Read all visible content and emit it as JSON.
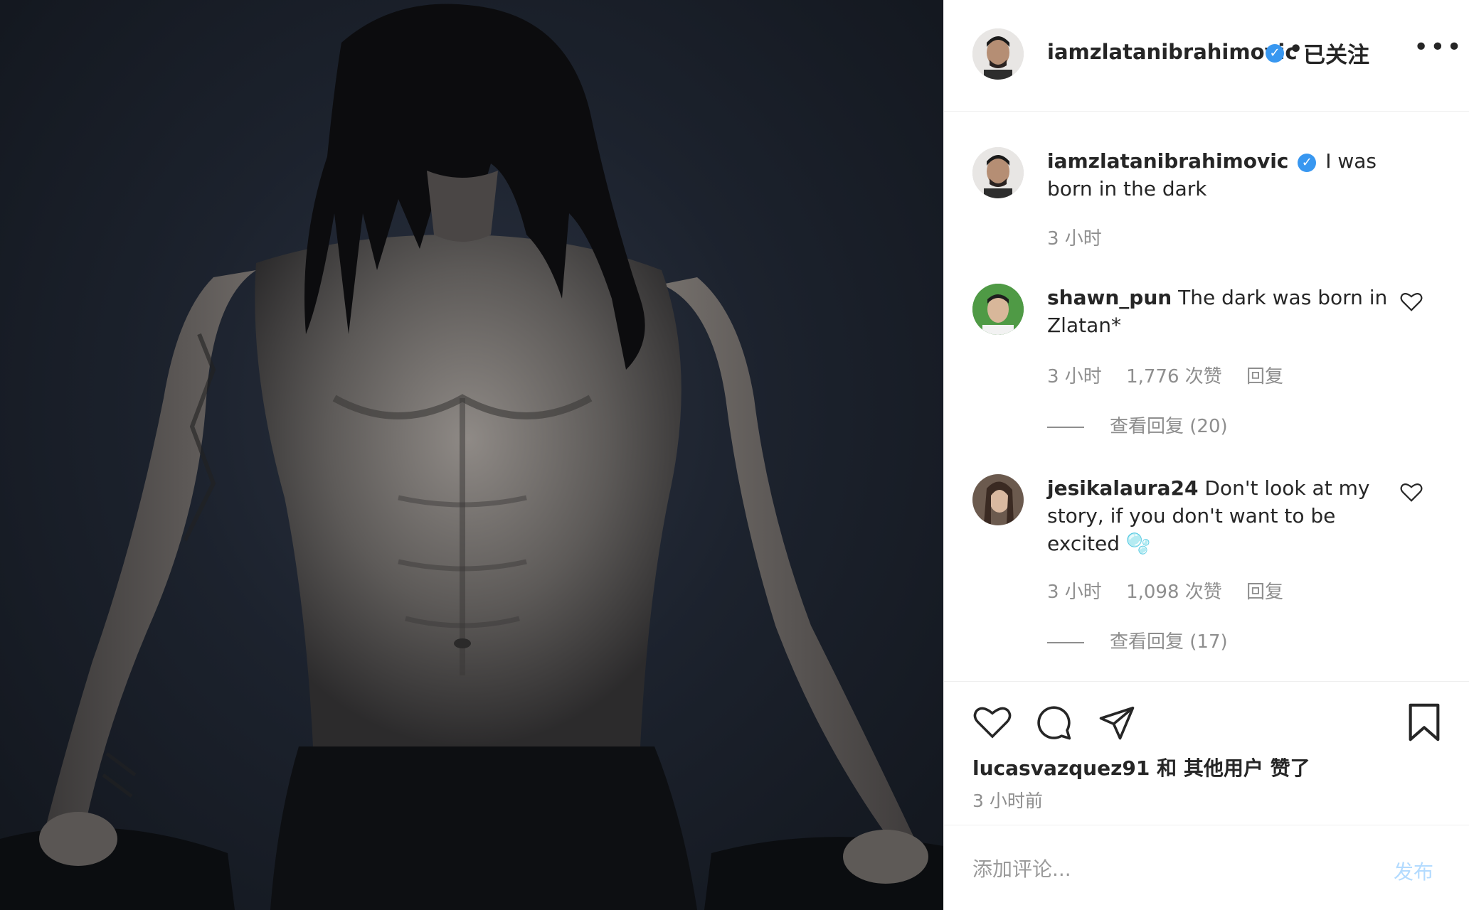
{
  "post": {
    "author": "iamzlatanibrahimovic",
    "follow_status": "已关注",
    "separator": "•",
    "more": "•••"
  },
  "caption": {
    "username": "iamzlatanibrahimovic",
    "text": "I was born in the dark",
    "time": "3 小时"
  },
  "comments": [
    {
      "username": "shawn_pun",
      "text": "The dark was born in Zlatan*",
      "time": "3 小时",
      "likes": "1,776 次赞",
      "reply_label": "回复",
      "view_replies": "查看回复 (20)"
    },
    {
      "username": "jesikalaura24",
      "text": "Don't look at my story, if you don't want to be excited 🫧",
      "time": "3 小时",
      "likes": "1,098 次赞",
      "reply_label": "回复",
      "view_replies": "查看回复 (17)"
    }
  ],
  "likes_line": {
    "user": "lucasvazquez91",
    "rest": " 和 其他用户 赞了"
  },
  "post_time": "3 小时前",
  "add_comment": {
    "placeholder": "添加评论...",
    "post_label": "发布"
  },
  "icons": {
    "verified": "verified-badge-icon",
    "heart": "heart-icon",
    "comment": "comment-icon",
    "share": "share-icon",
    "save": "bookmark-icon",
    "more": "more-options-icon"
  },
  "colors": {
    "verified_blue": "#3897f0",
    "muted_text": "#8e8e8e",
    "post_button_disabled": "#b3dbff"
  }
}
